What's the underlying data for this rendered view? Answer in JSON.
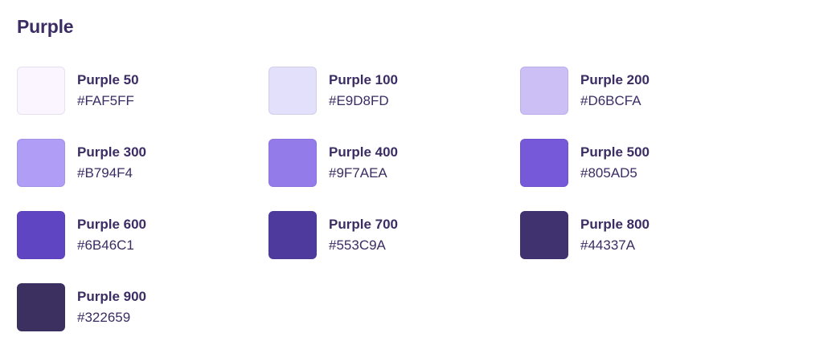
{
  "page": {
    "title": "Purple"
  },
  "swatches": [
    {
      "name": "Purple 50",
      "hex": "#FAF5FF",
      "color": "#FAF5FF"
    },
    {
      "name": "Purple 100",
      "hex": "#E9D8FD",
      "color": "#E3E0FB"
    },
    {
      "name": "Purple 200",
      "hex": "#D6BCFA",
      "color": "#CBBFF6"
    },
    {
      "name": "Purple 300",
      "hex": "#B794F4",
      "color": "#B09DF5"
    },
    {
      "name": "Purple 400",
      "hex": "#9F7AEA",
      "color": "#937CEA"
    },
    {
      "name": "Purple 500",
      "hex": "#805AD5",
      "color": "#7559D9"
    },
    {
      "name": "Purple 600",
      "hex": "#6B46C1",
      "color": "#5F45C2"
    },
    {
      "name": "Purple 700",
      "hex": "#553C9A",
      "color": "#4E3A9C"
    },
    {
      "name": "Purple 800",
      "hex": "#44337A",
      "color": "#40326F"
    },
    {
      "name": "Purple 900",
      "hex": "#322659",
      "color": "#3B3060"
    }
  ]
}
